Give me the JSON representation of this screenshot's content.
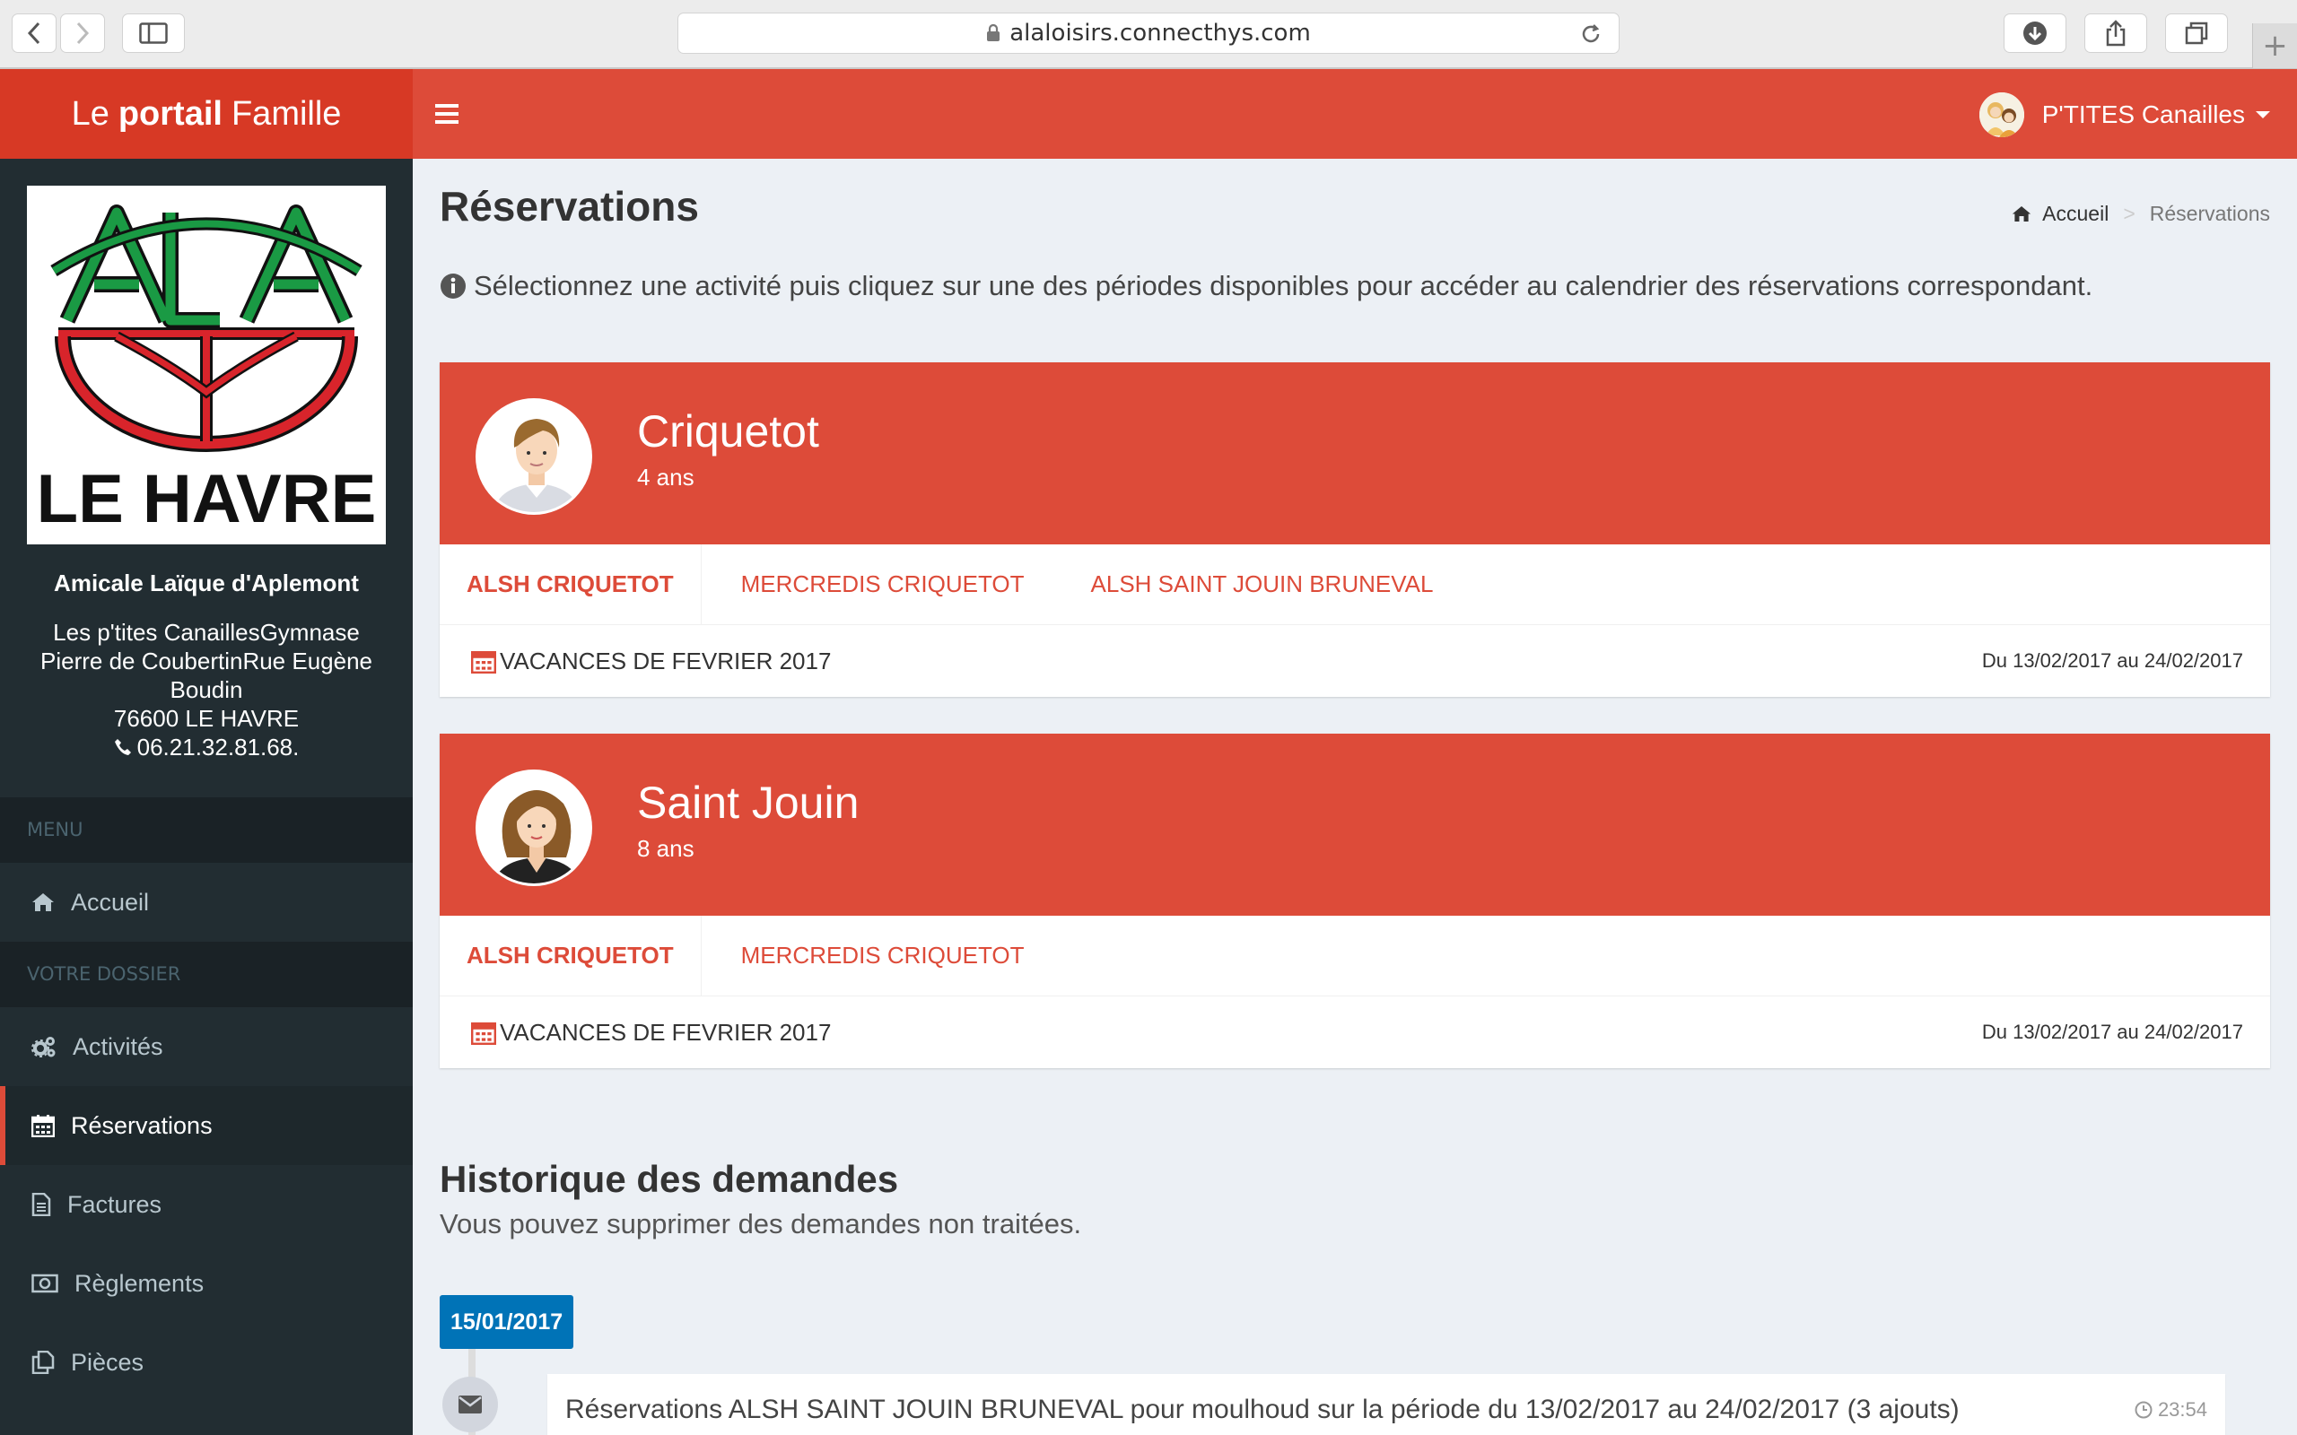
{
  "browser": {
    "url": "alaloisirs.connecthys.com"
  },
  "header": {
    "brand_prefix": "Le",
    "brand_bold": "portail",
    "brand_suffix": "Famille",
    "user_name": "P'TITES Canailles"
  },
  "sidebar": {
    "logo_text": "ALA",
    "logo_city": "LE HAVRE",
    "org_name": "Amicale Laïque d'Aplemont",
    "address_line1": "Les p'tites CanaillesGymnase",
    "address_line2": "Pierre de CoubertinRue Eugène",
    "address_line3": "Boudin",
    "address_line4": "76600 LE HAVRE",
    "phone": "06.21.32.81.68.",
    "menu_header": "MENU",
    "dossier_header": "VOTRE DOSSIER",
    "items": [
      {
        "label": "Accueil",
        "icon": "home-icon"
      },
      {
        "label": "Activités",
        "icon": "cogs-icon"
      },
      {
        "label": "Réservations",
        "icon": "calendar-icon"
      },
      {
        "label": "Factures",
        "icon": "file-icon"
      },
      {
        "label": "Règlements",
        "icon": "money-icon"
      },
      {
        "label": "Pièces",
        "icon": "files-icon"
      }
    ]
  },
  "page": {
    "title": "Réservations",
    "breadcrumb_home": "Accueil",
    "breadcrumb_sep": ">",
    "breadcrumb_current": "Réservations",
    "info": "Sélectionnez une activité puis cliquez sur une des périodes disponibles pour accéder au calendrier des réservations correspondant."
  },
  "children": [
    {
      "name": "Criquetot",
      "age": "4 ans",
      "tabs": [
        "ALSH CRIQUETOT",
        "MERCREDIS CRIQUETOT",
        "ALSH SAINT JOUIN BRUNEVAL"
      ],
      "period_name": "VACANCES DE FEVRIER 2017",
      "period_dates": "Du 13/02/2017 au 24/02/2017"
    },
    {
      "name": "Saint Jouin",
      "age": "8 ans",
      "tabs": [
        "ALSH CRIQUETOT",
        "MERCREDIS CRIQUETOT"
      ],
      "period_name": "VACANCES DE FEVRIER 2017",
      "period_dates": "Du 13/02/2017 au 24/02/2017"
    }
  ],
  "history": {
    "title": "Historique des demandes",
    "subtitle": "Vous pouvez supprimer des demandes non traitées.",
    "date": "15/01/2017",
    "item_text": "Réservations ALSH SAINT JOUIN BRUNEVAL pour moulhoud sur la période du 13/02/2017 au 24/02/2017 (3 ajouts)",
    "item_time": "23:54"
  },
  "colors": {
    "accent": "#dd4b39",
    "accent_dark": "#d73925",
    "sidebar_bg": "#222d32",
    "badge_blue": "#0073b7"
  }
}
